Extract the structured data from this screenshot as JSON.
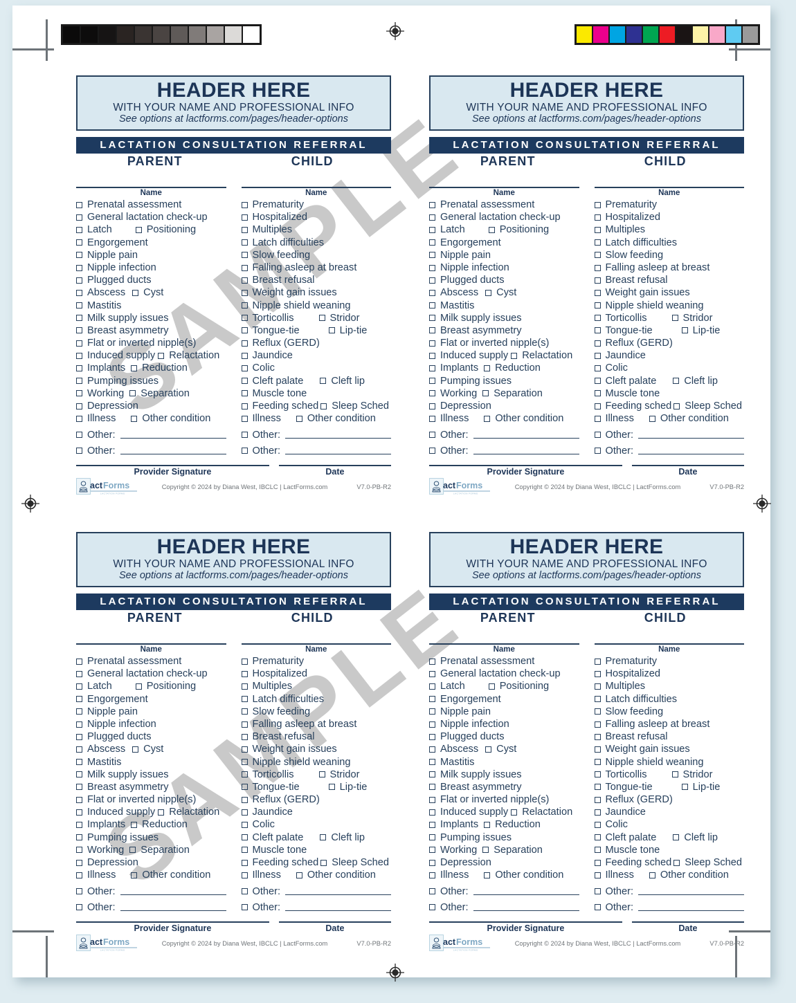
{
  "page": {
    "background_color": "#dfecf1",
    "sheet_color": "#ffffff",
    "watermark_text": "SAMPLE"
  },
  "calibration": {
    "gray_strip_label": "grayscale-calibration-strip",
    "gray_swatches": [
      "#0b0a0a",
      "#0d0c0c",
      "#161414",
      "#2a2422",
      "#3a3432",
      "#4a4442",
      "#5f5a58",
      "#807b79",
      "#a9a4a2",
      "#dcdad8",
      "#ffffff"
    ],
    "color_strip_label": "color-calibration-strip",
    "color_swatches": [
      "#fbe900",
      "#ec008c",
      "#00a5e3",
      "#2e3192",
      "#00a651",
      "#ed1c24",
      "#1a1414",
      "#fdf3a8",
      "#f9a8c8",
      "#5fcbf2",
      "#9a9a9a"
    ]
  },
  "form": {
    "header": {
      "title": "HEADER HERE",
      "subtitle": "WITH YOUR NAME AND PROFESSIONAL INFO",
      "link": "See options at lactforms.com/pages/header-options"
    },
    "band_title": "LACTATION CONSULTATION REFERRAL",
    "parent_label": "PARENT",
    "child_label": "CHILD",
    "name_label": "Name",
    "other_label": "Other:",
    "parent_items": [
      {
        "label": "Prenatal assessment"
      },
      {
        "label": "General lactation check-up"
      },
      {
        "label": "Latch",
        "second": "Positioning",
        "gap": 34
      },
      {
        "label": "Engorgement"
      },
      {
        "label": "Nipple pain"
      },
      {
        "label": "Nipple infection"
      },
      {
        "label": "Plugged ducts"
      },
      {
        "label": "Abscess",
        "second": "Cyst",
        "gap": 10
      },
      {
        "label": "Mastitis"
      },
      {
        "label": "Milk supply issues"
      },
      {
        "label": "Breast asymmetry"
      },
      {
        "label": "Flat or inverted nipple(s)"
      },
      {
        "label": "Induced supply",
        "second": "Relactation",
        "gap": 4
      },
      {
        "label": "Implants",
        "second": "Reduction",
        "gap": 8
      },
      {
        "label": "Pumping issues"
      },
      {
        "label": "Working",
        "second": "Separation",
        "gap": 8
      },
      {
        "label": "Depression"
      },
      {
        "label": "Illness",
        "second": "Other condition",
        "gap": 22
      }
    ],
    "child_items": [
      {
        "label": "Prematurity"
      },
      {
        "label": "Hospitalized"
      },
      {
        "label": "Multiples"
      },
      {
        "label": "Latch difficulties"
      },
      {
        "label": "Slow feeding"
      },
      {
        "label": "Falling asleep at breast"
      },
      {
        "label": "Breast refusal"
      },
      {
        "label": "Weight gain issues"
      },
      {
        "label": "Nipple shield weaning"
      },
      {
        "label": "Torticollis",
        "second": "Stridor",
        "gap": 36
      },
      {
        "label": "Tongue-tie",
        "second": "Lip-tie",
        "gap": 42
      },
      {
        "label": "Reflux (GERD)"
      },
      {
        "label": "Jaundice"
      },
      {
        "label": "Colic"
      },
      {
        "label": "Cleft palate",
        "second": "Cleft lip",
        "gap": 24
      },
      {
        "label": "Muscle tone"
      },
      {
        "label": "Feeding sched",
        "second": "Sleep Sched",
        "gap": 3
      },
      {
        "label": "Illness",
        "second": "Other condition",
        "gap": 22
      }
    ],
    "footer": {
      "signature_label": "Provider Signature",
      "date_label": "Date",
      "copyright": "Copyright © 2024 by Diana West, IBCLC  |  LactForms.com",
      "version": "V7.0-PB-R2",
      "logo_text_1": "act",
      "logo_text_2": "Forms"
    }
  },
  "colors": {
    "navy": "#1d3a5f",
    "text_navy": "#27405c",
    "header_fill": "#d9e8f0",
    "page_bg": "#dfecf1"
  }
}
